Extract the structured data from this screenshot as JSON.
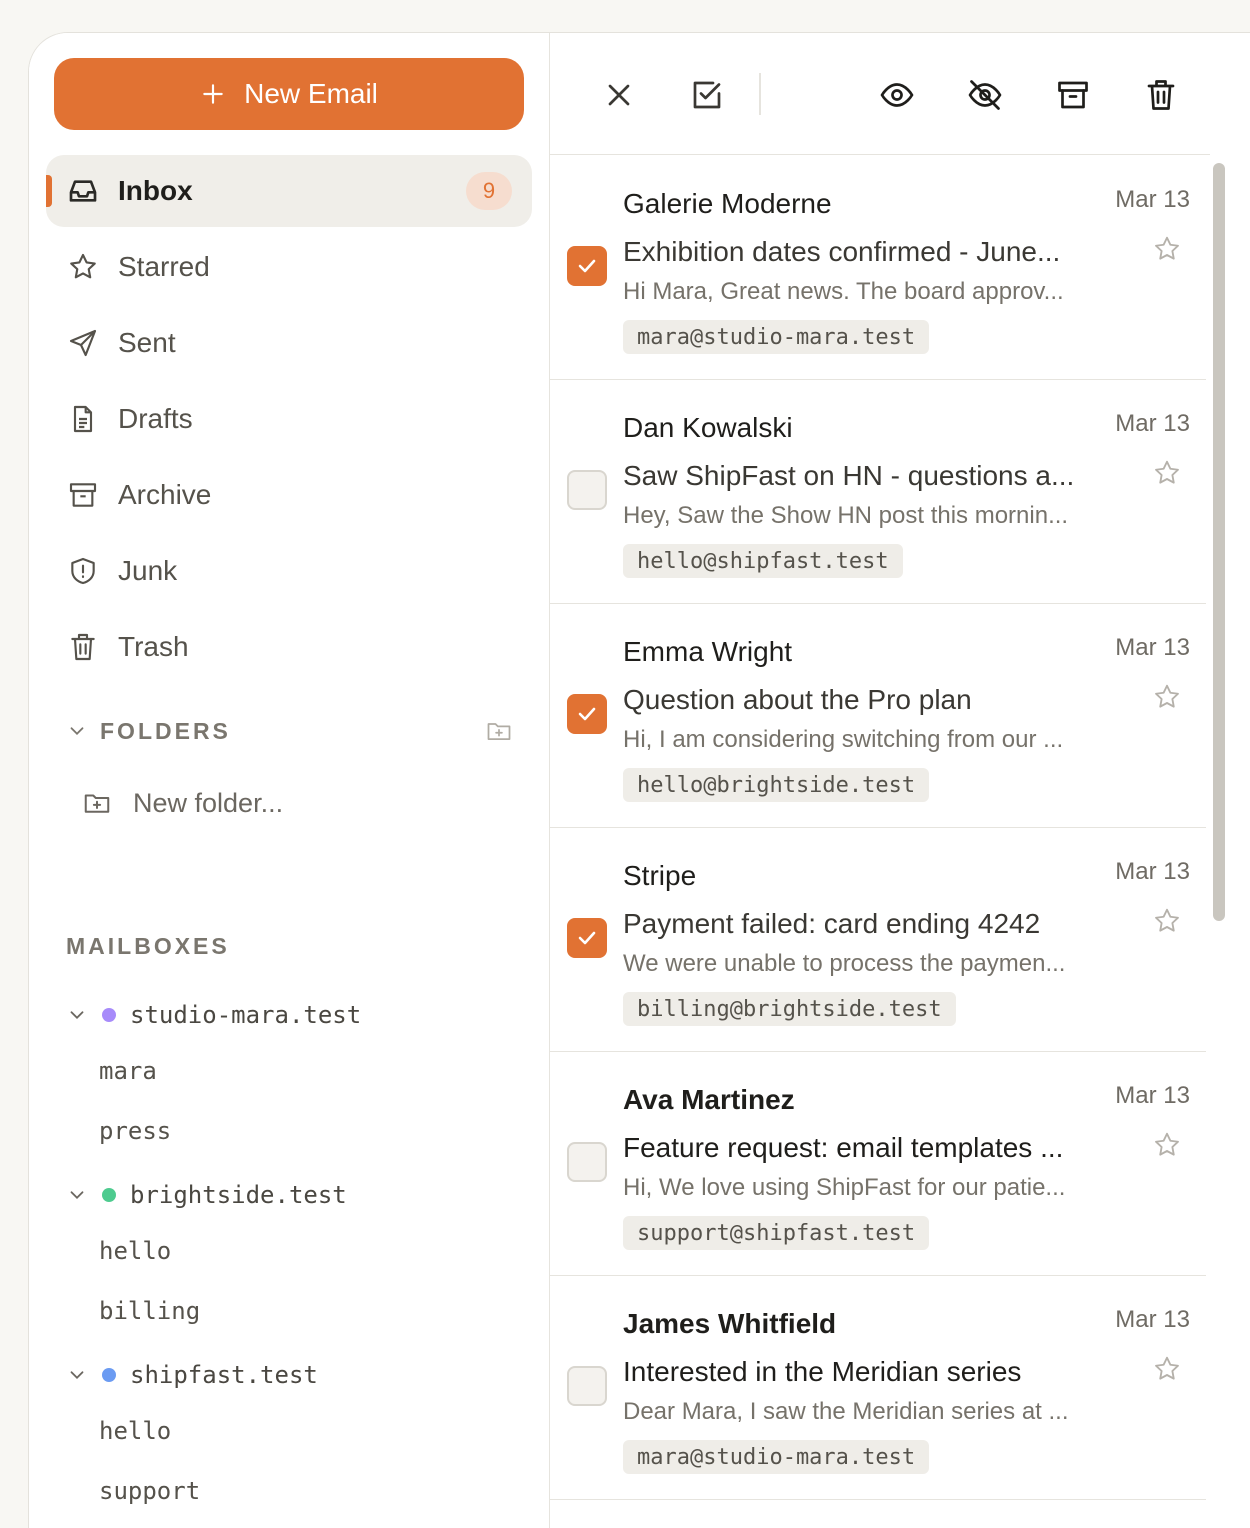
{
  "compose": {
    "label": "New Email"
  },
  "nav": {
    "items": [
      {
        "id": "inbox",
        "label": "Inbox",
        "icon": "inbox-icon",
        "badge": "9",
        "active": true
      },
      {
        "id": "starred",
        "label": "Starred",
        "icon": "star-icon"
      },
      {
        "id": "sent",
        "label": "Sent",
        "icon": "send-icon"
      },
      {
        "id": "drafts",
        "label": "Drafts",
        "icon": "file-icon"
      },
      {
        "id": "archive",
        "label": "Archive",
        "icon": "archive-icon"
      },
      {
        "id": "junk",
        "label": "Junk",
        "icon": "shield-alert-icon"
      },
      {
        "id": "trash",
        "label": "Trash",
        "icon": "trash-icon"
      }
    ]
  },
  "folders": {
    "heading": "FOLDERS",
    "new_folder_label": "New folder..."
  },
  "mailboxes": {
    "heading": "MAILBOXES",
    "domains": [
      {
        "name": "studio-mara.test",
        "color": "#a78bfa",
        "addresses": [
          "mara",
          "press"
        ]
      },
      {
        "name": "brightside.test",
        "color": "#4ecb8f",
        "addresses": [
          "hello",
          "billing"
        ]
      },
      {
        "name": "shipfast.test",
        "color": "#6b9bf2",
        "addresses": [
          "hello",
          "support"
        ]
      }
    ]
  },
  "toolbar": {
    "actions": [
      "close-icon",
      "select-all-icon",
      "mark-read-icon",
      "mark-unread-icon",
      "archive-icon",
      "delete-icon"
    ]
  },
  "emails": [
    {
      "sender": "Galerie Moderne",
      "date": "Mar 13",
      "subject": "Exhibition dates confirmed - June...",
      "preview": "Hi Mara, Great news. The board approv...",
      "mailbox": "mara@studio-mara.test",
      "checked": true,
      "unread": false
    },
    {
      "sender": "Dan Kowalski",
      "date": "Mar 13",
      "subject": "Saw ShipFast on HN - questions a...",
      "preview": "Hey, Saw the Show HN post this mornin...",
      "mailbox": "hello@shipfast.test",
      "checked": false,
      "unread": false
    },
    {
      "sender": "Emma Wright",
      "date": "Mar 13",
      "subject": "Question about the Pro plan",
      "preview": "Hi, I am considering switching from our ...",
      "mailbox": "hello@brightside.test",
      "checked": true,
      "unread": false
    },
    {
      "sender": "Stripe",
      "date": "Mar 13",
      "subject": "Payment failed: card ending 4242",
      "preview": "We were unable to process the paymen...",
      "mailbox": "billing@brightside.test",
      "checked": true,
      "unread": false
    },
    {
      "sender": "Ava Martinez",
      "date": "Mar 13",
      "subject": "Feature request: email templates ...",
      "preview": "Hi, We love using ShipFast for our patie...",
      "mailbox": "support@shipfast.test",
      "checked": false,
      "unread": true
    },
    {
      "sender": "James Whitfield",
      "date": "Mar 13",
      "subject": "Interested in the Meridian series",
      "preview": "Dear Mara, I saw the Meridian series at ...",
      "mailbox": "mara@studio-mara.test",
      "checked": false,
      "unread": true
    }
  ],
  "colors": {
    "accent": "#e17233",
    "accent_soft": "#f6ddcf"
  }
}
